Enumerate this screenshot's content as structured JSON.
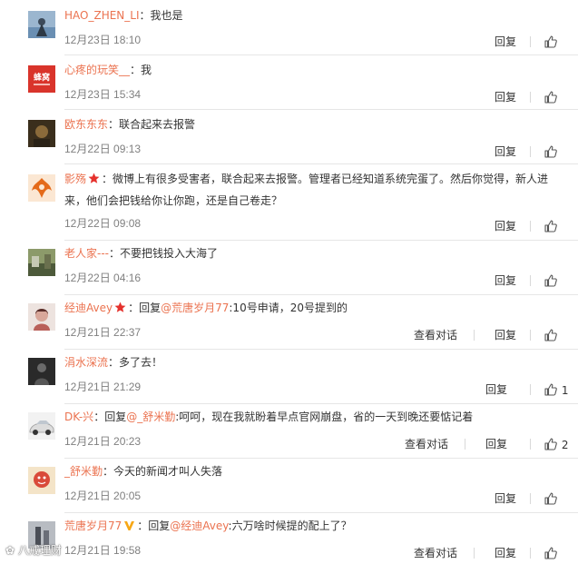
{
  "comments": [
    {
      "name": "HAO_ZHEN_LI",
      "text": "：我也是",
      "time": "12月23日 18:10",
      "reply": "回复",
      "like": "",
      "avatar_color": "#6a8fb3"
    },
    {
      "name": "心疼的玩笑__",
      "text": "：我",
      "time": "12月23日 15:34",
      "reply": "回复",
      "like": "",
      "avatar_color": "#d9342b",
      "avatar_text": "蜂窝"
    },
    {
      "name": "欧东东东",
      "text": "：联合起来去报警",
      "time": "12月22日 09:13",
      "reply": "回复",
      "like": "",
      "avatar_color": "#5a4a2c"
    },
    {
      "name": "影殇",
      "text": "：微博上有很多受害者，联合起来去报警。管理者已经知道系统完蛋了。然后你觉得，新人进来，他们会把钱给你让你跑，还是自己卷走？",
      "time": "12月22日 09:08",
      "reply": "回复",
      "like": "",
      "avatar_color": "#e46a1a"
    },
    {
      "name": "老人家---",
      "text": "：不要把钱投入大海了",
      "time": "12月22日 04:16",
      "reply": "回复",
      "like": "",
      "avatar_color": "#6f7a55"
    },
    {
      "name": "经迪Avey",
      "reply_prefix": "：回复",
      "reply_to": "@荒唐岁月77",
      "text": ":10号申请，20号提到的",
      "time": "12月21日 22:37",
      "view": "查看对话",
      "reply": "回复",
      "like": "",
      "avatar_color": "#c9a7a0"
    },
    {
      "name": "涓水深流",
      "text": "：多了去！",
      "time": "12月21日 21:29",
      "reply": "回复",
      "like": "1",
      "avatar_color": "#4b4b4b"
    },
    {
      "name": "DK-兴",
      "reply_prefix": "：回复",
      "reply_to": "@_舒米勤",
      "text": ":呵呵，现在我就盼着早点官网崩盘，省的一天到晚还要惦记着",
      "time": "12月21日 20:23",
      "view": "查看对话",
      "reply": "回复",
      "like": "2",
      "avatar_color": "#e8e8e8"
    },
    {
      "name": "_舒米勤",
      "text": "：今天的新闻才叫人失落",
      "time": "12月21日 20:05",
      "reply": "回复",
      "like": "",
      "avatar_color": "#d94a3a"
    },
    {
      "name": "荒唐岁月77",
      "reply_prefix": "：回复",
      "reply_to": "@经迪Avey",
      "text": ":六万啥时候提的配上了？",
      "time": "12月21日 19:58",
      "view": "查看对话",
      "reply": "回复",
      "like": "",
      "avatar_color": "#7a7f88"
    }
  ],
  "watermark": "八戒理财",
  "colors": {
    "link": "#eb7350",
    "text": "#333333",
    "time": "#808080",
    "badge_red": "#e5322d",
    "badge_vip": "#f7a715"
  }
}
